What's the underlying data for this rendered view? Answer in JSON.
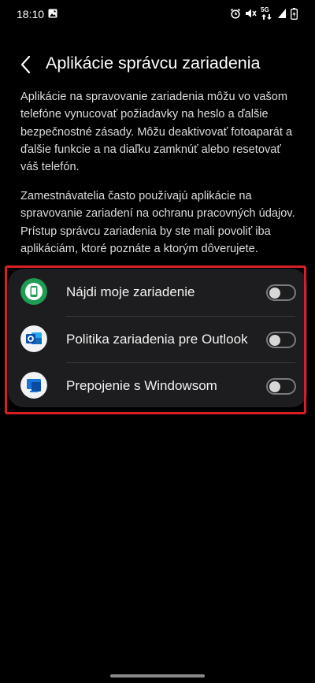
{
  "status_bar": {
    "time": "18:10",
    "network": "5G"
  },
  "header": {
    "back_icon": "chevron-left-icon",
    "title": "Aplikácie správcu zariadenia"
  },
  "descriptions": [
    "Aplikácie na spravovanie zariadenia môžu vo vašom telefóne vynucovať požiadavky na heslo a ďalšie bezpečnostné zásady. Môžu deaktivovať fotoaparát a ďalšie funkcie a na diaľku zamknúť alebo resetovať váš telefón.",
    "Zamestnávatelia často používajú aplikácie na spravovanie zariadení na ochranu pracovných údajov. Prístup správcu zariadenia by ste mali povoliť iba aplikáciám, ktoré poznáte a ktorým dôverujete."
  ],
  "apps": [
    {
      "label": "Nájdi moje zariadenie",
      "icon": "find-my-device-icon",
      "enabled": false
    },
    {
      "label": "Politika zariadenia pre Outlook",
      "icon": "outlook-icon",
      "enabled": false
    },
    {
      "label": "Prepojenie s Windowsom",
      "icon": "link-to-windows-icon",
      "enabled": false
    }
  ],
  "colors": {
    "background": "#000000",
    "card": "#1d1d1f",
    "highlight_border": "#d91f26",
    "find_my_device": "#1f9d55",
    "outlook": "#0f6cbd",
    "windows": "#1a73d9"
  }
}
